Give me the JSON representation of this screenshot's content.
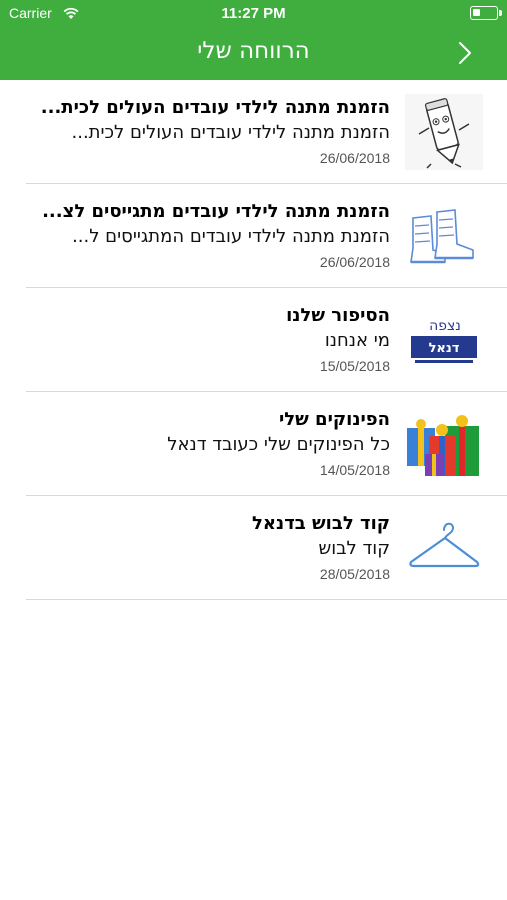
{
  "status_bar": {
    "carrier": "Carrier",
    "time": "11:27 PM"
  },
  "nav": {
    "title": "הרווחה שלי",
    "back_icon": "chevron-right-icon"
  },
  "colors": {
    "header": "#3fae3f"
  },
  "items": [
    {
      "title": "הזמנת מתנה לילדי עובדים העולים לכית...",
      "subtitle": "הזמנת מתנה לילדי עובדים העולים לכית...",
      "date": "26/06/2018",
      "icon": "pencil-character-icon"
    },
    {
      "title": "הזמנת מתנה לילדי עובדים מתגייסים לצ...",
      "subtitle": "הזמנת מתנה לילדי עובדים המתגייסים ל...",
      "date": "26/06/2018",
      "icon": "army-boots-icon"
    },
    {
      "title": "הסיפור שלנו",
      "subtitle": "מי אנחנו",
      "date": "15/05/2018",
      "icon": "danel-logo-icon",
      "logo_text": "נצפה",
      "logo_brand": "דנאל"
    },
    {
      "title": "הפינוקים שלי",
      "subtitle": "כל הפינוקים שלי כעובד דנאל",
      "date": "14/05/2018",
      "icon": "gift-boxes-icon"
    },
    {
      "title": "קוד לבוש בדנאל",
      "subtitle": "קוד לבוש",
      "date": "28/05/2018",
      "icon": "hanger-icon"
    }
  ]
}
